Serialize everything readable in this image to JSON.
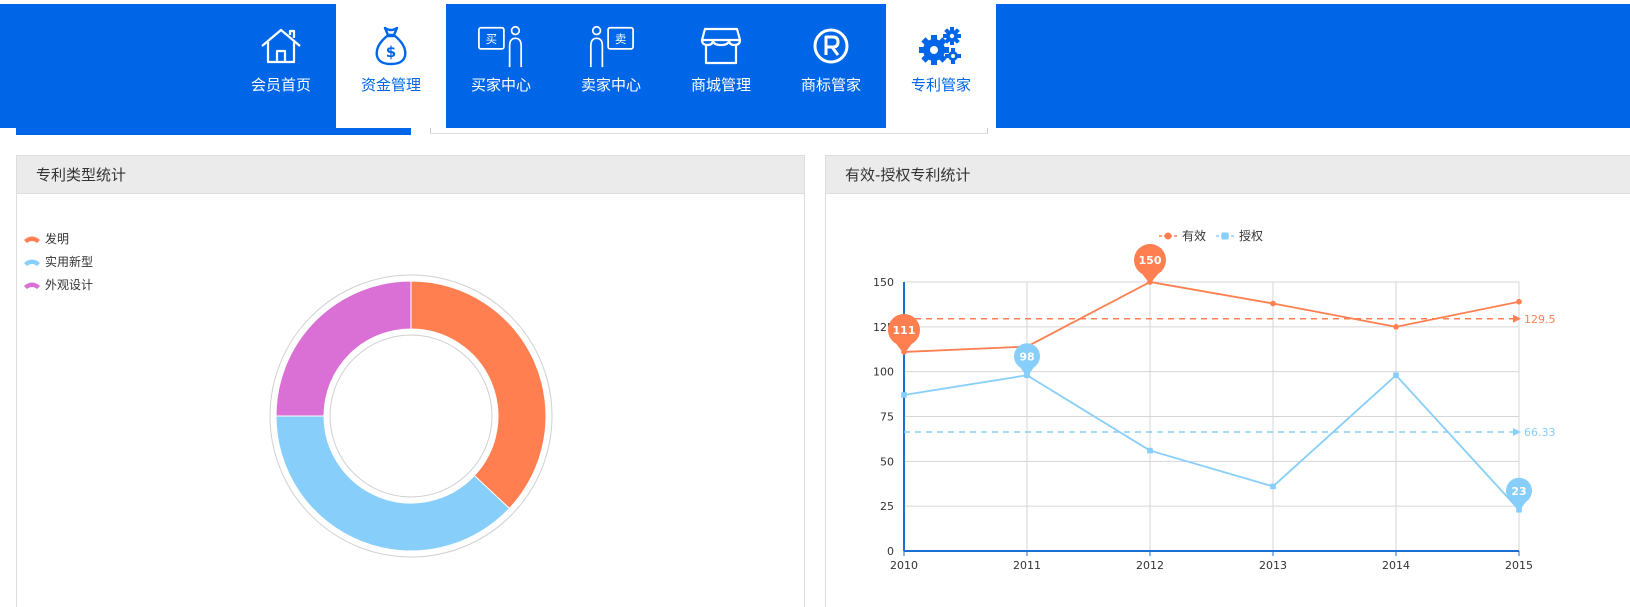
{
  "nav": {
    "items": [
      {
        "label": "会员首页",
        "icon": "home-icon",
        "active": false
      },
      {
        "label": "资金管理",
        "icon": "money-bag-icon",
        "active": true
      },
      {
        "label": "买家中心",
        "icon": "buyer-icon",
        "active": false
      },
      {
        "label": "卖家中心",
        "icon": "seller-icon",
        "active": false
      },
      {
        "label": "商城管理",
        "icon": "store-icon",
        "active": false
      },
      {
        "label": "商标管家",
        "icon": "registered-trademark-icon",
        "active": false
      },
      {
        "label": "专利管家",
        "icon": "gears-icon",
        "active": true
      }
    ]
  },
  "colors": {
    "brand": "#0066e8",
    "orange": "#ff7f50",
    "lightblue": "#87cefa",
    "orchid": "#da70d6"
  },
  "panels": {
    "left_title": "专利类型统计",
    "right_title": "有效-授权专利统计"
  },
  "chart_data": [
    {
      "type": "pie",
      "variant": "donut",
      "title": "",
      "legend_position": "top-left",
      "slices": [
        {
          "name": "发明",
          "value": 37,
          "color": "#ff7f50"
        },
        {
          "name": "实用新型",
          "value": 38,
          "color": "#87cefa"
        },
        {
          "name": "外观设计",
          "value": 25,
          "color": "#da70d6"
        }
      ]
    },
    {
      "type": "line",
      "title": "",
      "legend_position": "top-center",
      "x": [
        "2010",
        "2011",
        "2012",
        "2013",
        "2014",
        "2015"
      ],
      "ylim": [
        0,
        150
      ],
      "yticks": [
        "0",
        "25",
        "50",
        "75",
        "100",
        "125",
        "150"
      ],
      "grid": true,
      "series": [
        {
          "name": "有效",
          "values": [
            111,
            114,
            150,
            138,
            125,
            139
          ],
          "color": "#ff7f50",
          "mean": 129.5,
          "mean_label": "129.5",
          "max_label": "150",
          "min_label": "111"
        },
        {
          "name": "授权",
          "values": [
            87,
            98,
            56,
            36,
            98,
            23
          ],
          "color": "#87cefa",
          "mean": 66.33,
          "mean_label": "66.33",
          "max_label": "98",
          "min_label": "23"
        }
      ]
    }
  ]
}
